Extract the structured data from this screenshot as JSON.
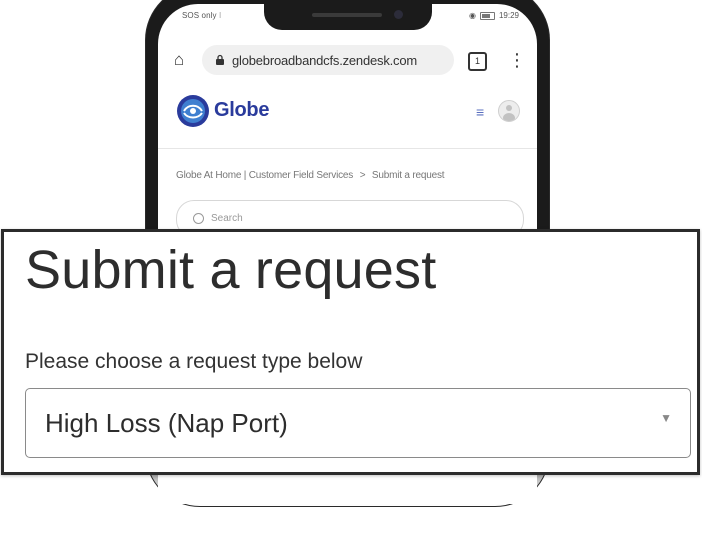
{
  "phone": {
    "status_bar": {
      "carrier": "SOS only",
      "time": "19:29"
    },
    "browser": {
      "url": "globebroadbandcfs.zendesk.com",
      "tab_count": "1"
    },
    "site_header": {
      "brand_name": "Globe"
    },
    "breadcrumb": {
      "items": [
        "Globe At Home | Customer Field Services",
        "Submit a request"
      ],
      "separator": ">"
    },
    "search": {
      "placeholder": "Search"
    }
  },
  "callout": {
    "title": "Submit a request",
    "request_type_label": "Please choose a request type below",
    "request_type_selected": "High Loss (Nap Port)"
  },
  "colors": {
    "brand_blue": "#2a3b9c",
    "text_dark": "#2d2d2d",
    "callout_border": "#2b2b2b",
    "phone_body": "#1b1b1b"
  },
  "icons": [
    "home-icon",
    "lock-icon",
    "tabs-icon",
    "more-vertical-icon",
    "globe-logo-icon",
    "menu-icon",
    "user-avatar-icon",
    "search-icon",
    "chevron-down-icon",
    "wifi-icon",
    "battery-icon"
  ]
}
